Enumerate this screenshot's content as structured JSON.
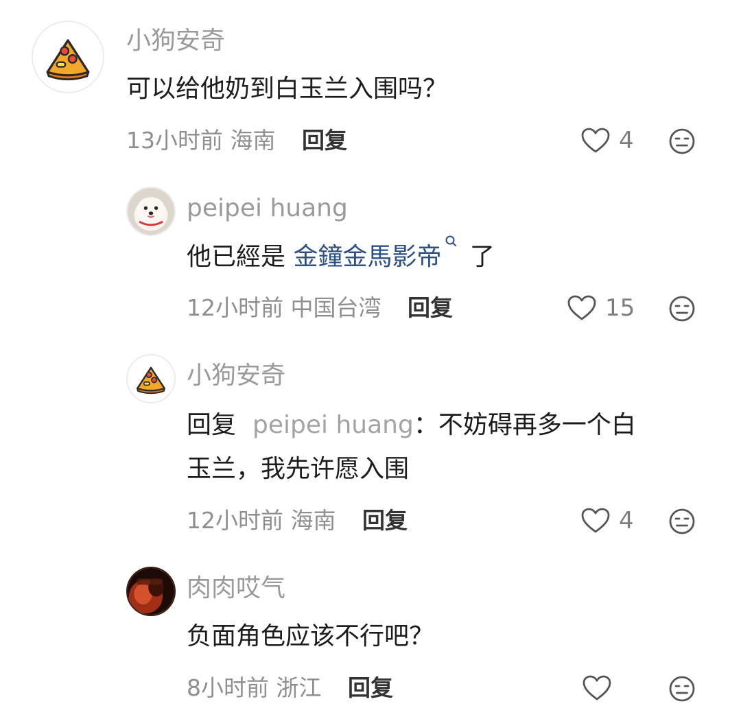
{
  "comments": [
    {
      "username": "小狗安奇",
      "text": "可以给他奶到白玉兰入围吗？",
      "time": "13小时前",
      "location": "海南",
      "reply_label": "回复",
      "likes": "4",
      "avatar_icon": "pizza-icon"
    },
    {
      "username": "peipei huang",
      "text_before": "他已經是 ",
      "link_text": "金鐘金馬影帝",
      "text_after": " 了",
      "time": "12小时前",
      "location": "中国台湾",
      "reply_label": "回复",
      "likes": "15",
      "avatar_icon": "dog-photo-avatar"
    },
    {
      "username": "小狗安奇",
      "reply_prefix": "回复",
      "reply_to": "peipei huang",
      "reply_colon": "：",
      "text_line1": "不妨碍再多一个白",
      "text_line2": "玉兰，我先许愿入围",
      "time": "12小时前",
      "location": "海南",
      "reply_label": "回复",
      "likes": "4",
      "avatar_icon": "pizza-icon"
    },
    {
      "username": "肉肉哎气",
      "text": "负面角色应该不行吧？",
      "time": "8小时前",
      "location": "浙江",
      "reply_label": "回复",
      "likes": "",
      "avatar_icon": "dark-photo-avatar"
    }
  ],
  "colors": {
    "username": "#9a9a9a",
    "link": "#2b4f86",
    "meta": "#8f8f8f"
  }
}
